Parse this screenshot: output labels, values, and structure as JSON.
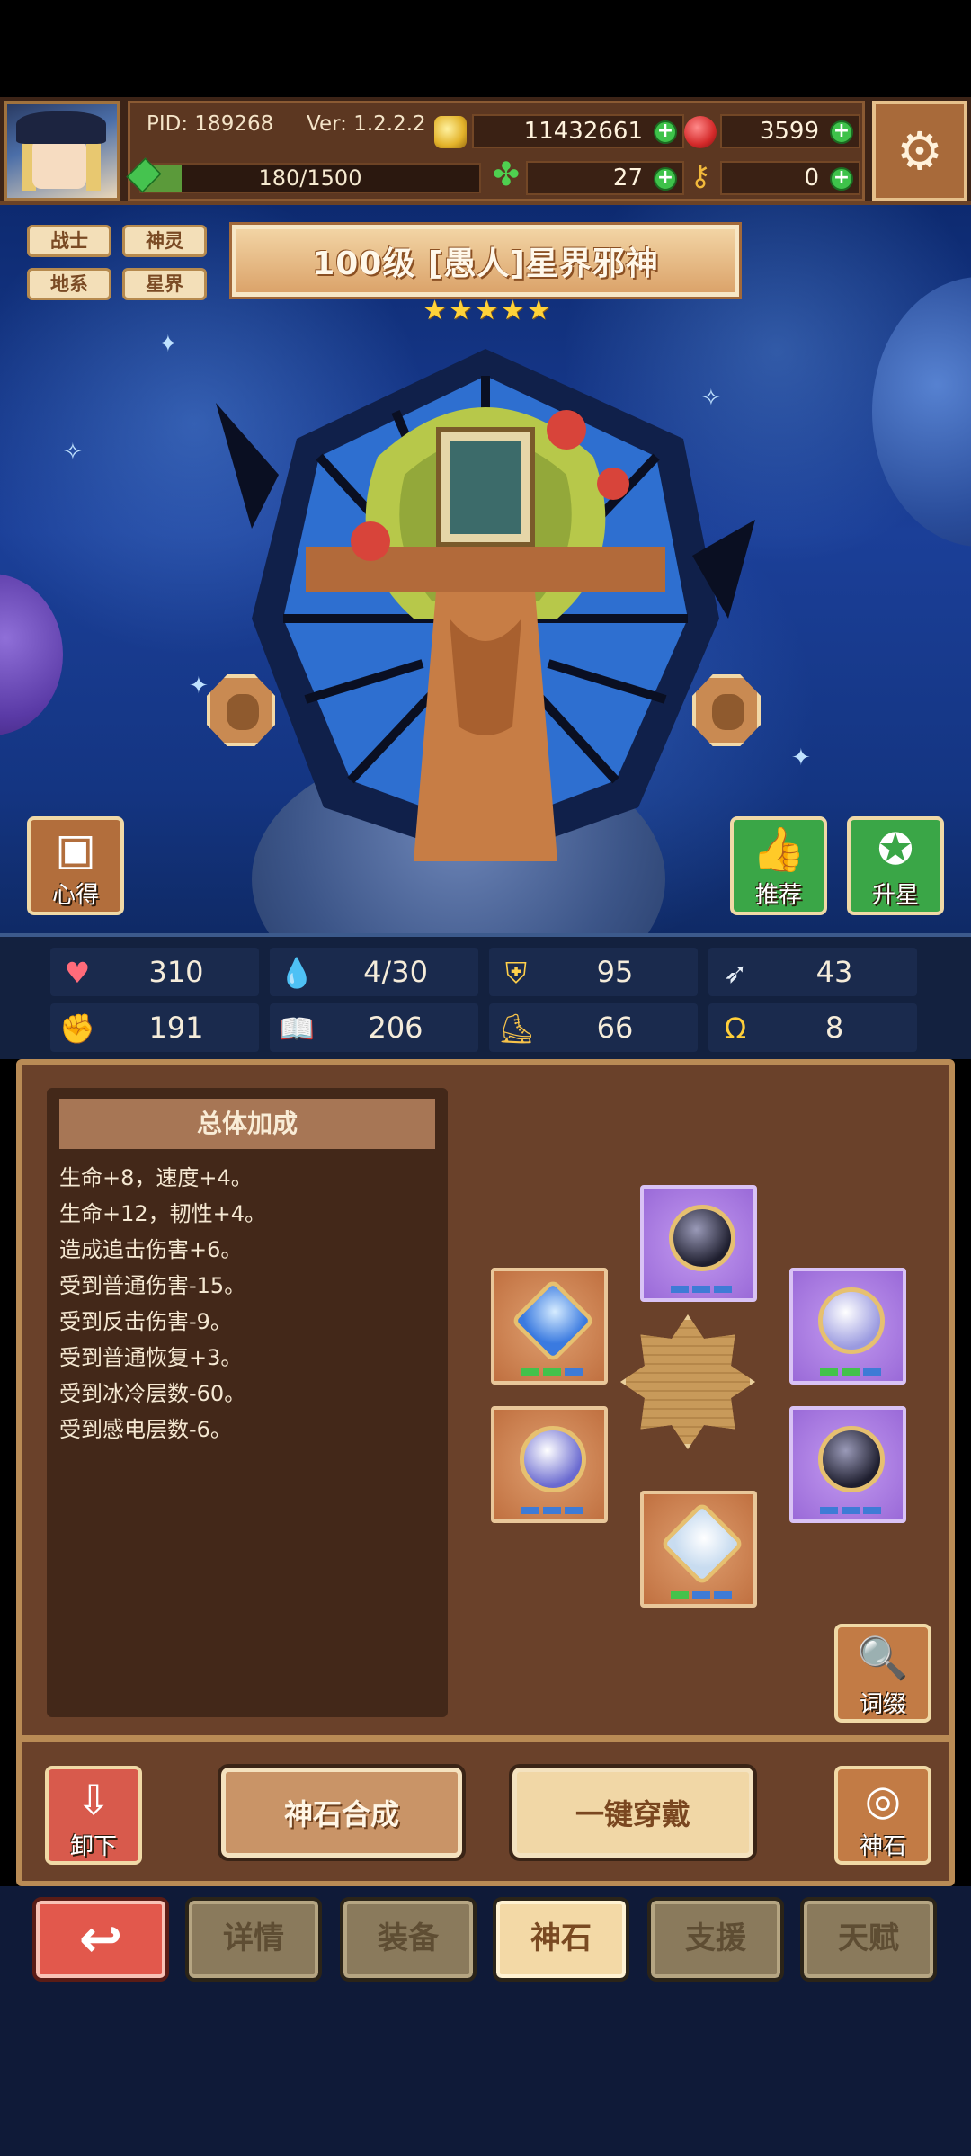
{
  "header": {
    "pid": "PID: 189268",
    "version": "Ver: 1.2.2.2",
    "gold": "11432661",
    "ruby": "3599",
    "exp": "180/1500",
    "exp_progress": 0.12,
    "clover": "27",
    "key": "0"
  },
  "tags": [
    "战士",
    "神灵",
    "地系",
    "星界"
  ],
  "hero": {
    "title": "100级 [愚人]星界邪神",
    "stars": 5
  },
  "side_buttons": {
    "insight": "心得",
    "recommend": "推荐",
    "upgrade_star": "升星"
  },
  "stats": {
    "hp": "310",
    "mana": "4/30",
    "defense": "95",
    "speed": "43",
    "attack": "191",
    "intellect": "206",
    "toughness": "66",
    "luck": "8"
  },
  "bonus": {
    "title": "总体加成",
    "lines": [
      "生命+8，速度+4。",
      "生命+12，韧性+4。",
      "造成追击伤害+6。",
      "受到普通伤害-15。",
      "受到反击伤害-9。",
      "受到普通恢复+3。",
      "受到冰冷层数-60。",
      "受到感电层数-6。"
    ]
  },
  "panel_buttons": {
    "affix": "词缀",
    "unequip": "卸下",
    "synthesize": "神石合成",
    "equip_all": "一键穿戴",
    "godstone": "神石"
  },
  "tabs": [
    "详情",
    "装备",
    "神石",
    "支援",
    "天赋"
  ],
  "active_tab": "神石",
  "colors": {
    "accent_gold": "#f3d9a6",
    "panel_brown": "#6a412a",
    "back_red": "#e2584c",
    "plus_green": "#3ec24a"
  }
}
